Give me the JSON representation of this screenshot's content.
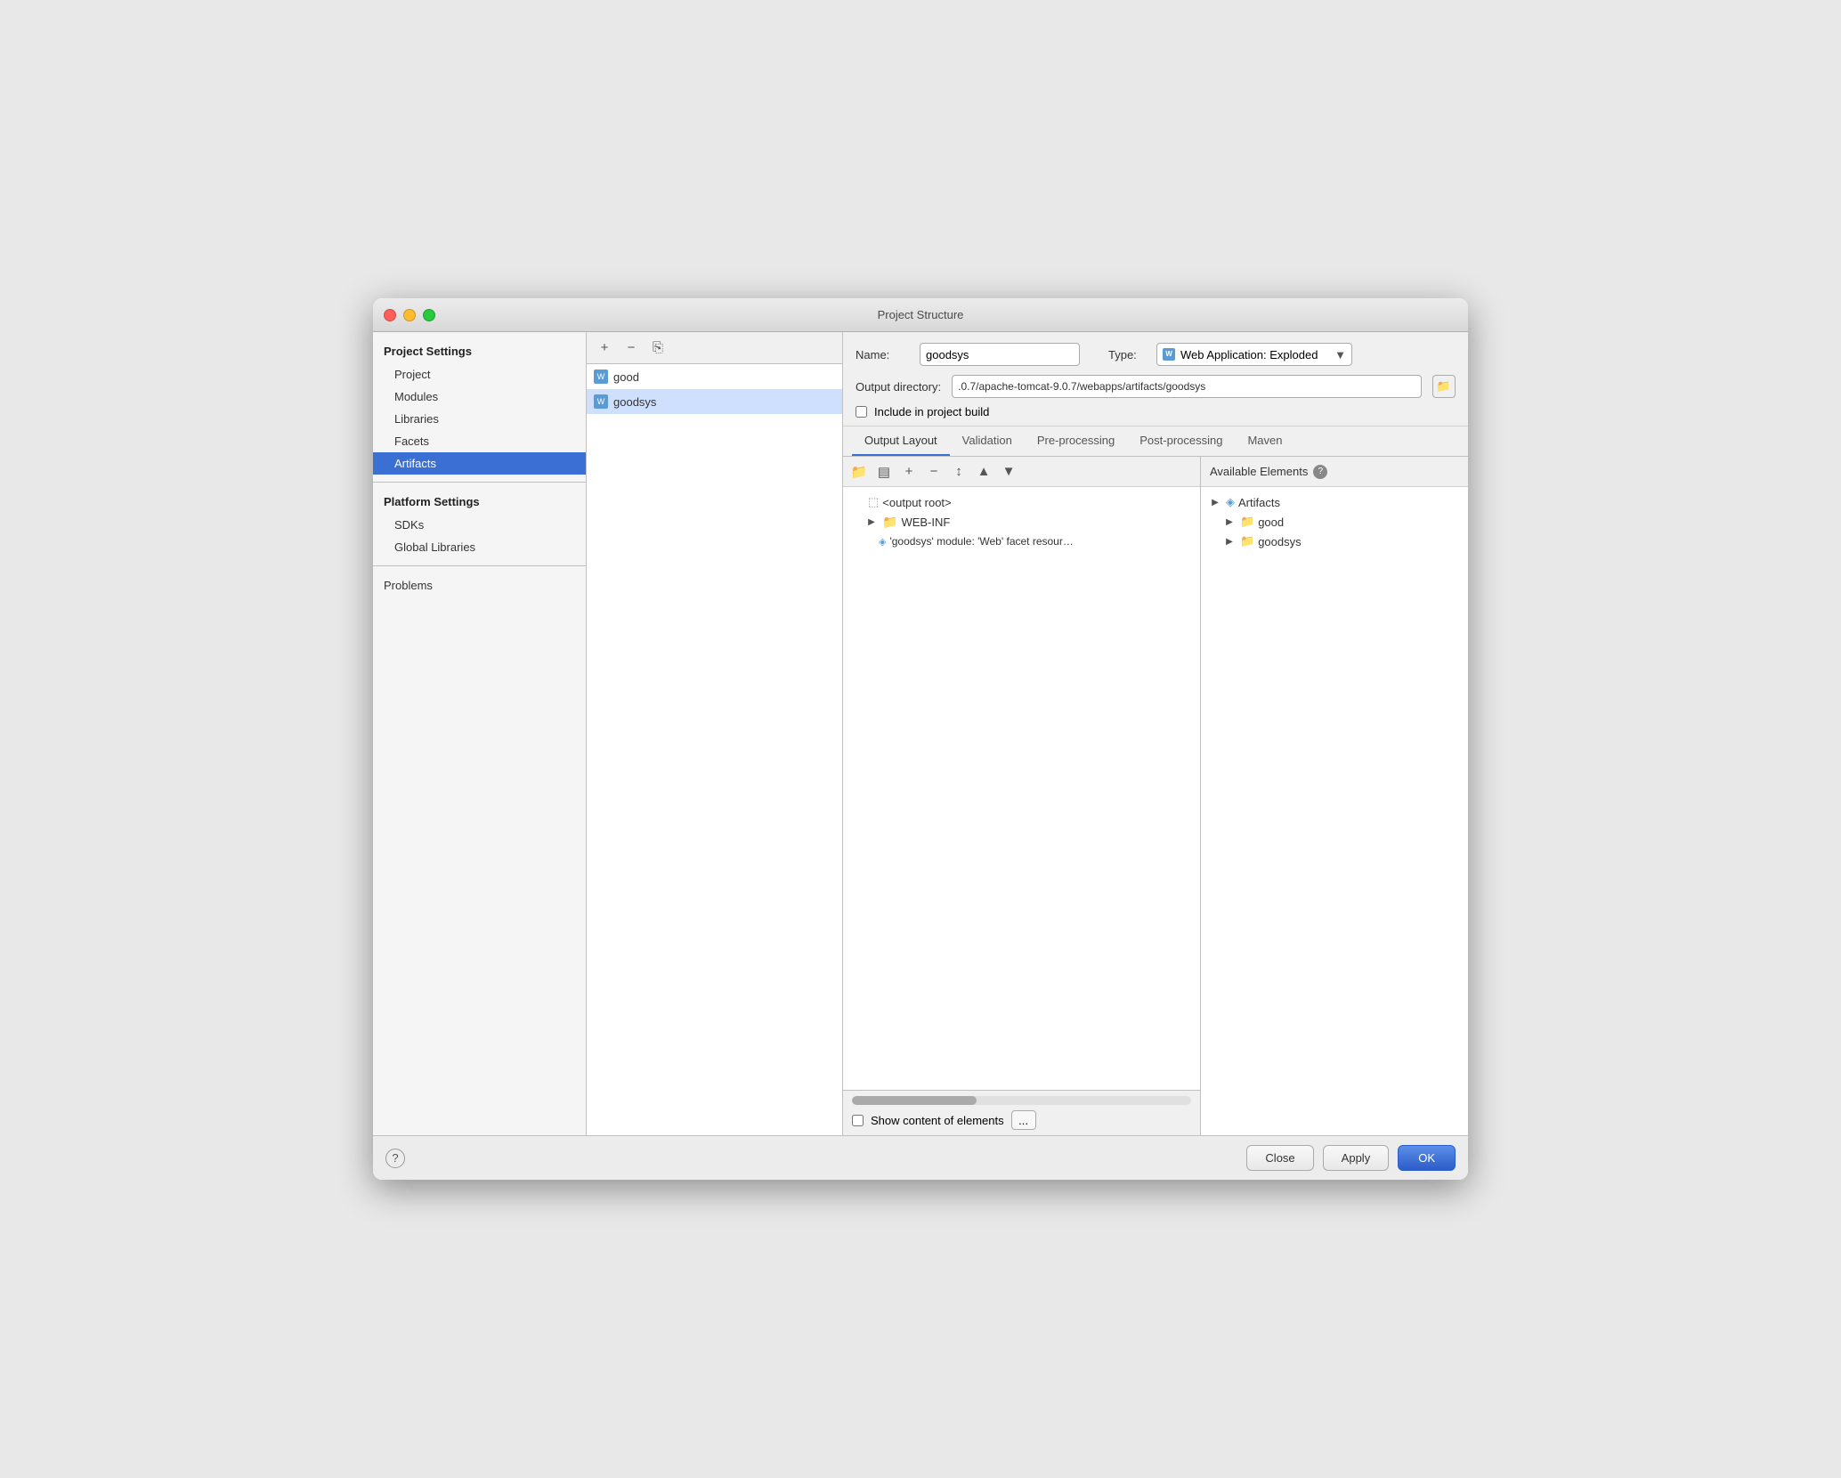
{
  "window": {
    "title": "Project Structure"
  },
  "sidebar": {
    "project_settings_header": "Project Settings",
    "items": [
      {
        "label": "Project",
        "id": "project"
      },
      {
        "label": "Modules",
        "id": "modules"
      },
      {
        "label": "Libraries",
        "id": "libraries"
      },
      {
        "label": "Facets",
        "id": "facets"
      },
      {
        "label": "Artifacts",
        "id": "artifacts",
        "active": true
      }
    ],
    "platform_settings_header": "Platform Settings",
    "platform_items": [
      {
        "label": "SDKs",
        "id": "sdks"
      },
      {
        "label": "Global Libraries",
        "id": "global-libraries"
      }
    ],
    "problems_label": "Problems"
  },
  "artifact_list": {
    "items": [
      {
        "name": "good",
        "id": "good"
      },
      {
        "name": "goodsys",
        "id": "goodsys",
        "selected": true
      }
    ]
  },
  "toolbar": {
    "add": "+",
    "remove": "−",
    "copy": "⎘"
  },
  "detail": {
    "name_label": "Name:",
    "name_value": "goodsys",
    "type_label": "Type:",
    "type_value": "Web Application: Exploded",
    "output_label": "Output directory:",
    "output_value": ".0.7/apache-tomcat-9.0.7/webapps/artifacts/goodsys",
    "include_in_build_label": "Include in project build"
  },
  "tabs": [
    {
      "label": "Output Layout",
      "active": true
    },
    {
      "label": "Validation"
    },
    {
      "label": "Pre-processing"
    },
    {
      "label": "Post-processing"
    },
    {
      "label": "Maven"
    }
  ],
  "tree": {
    "items": [
      {
        "label": "<output root>",
        "indent": 0,
        "type": "root",
        "arrow": false
      },
      {
        "label": "WEB-INF",
        "indent": 1,
        "type": "folder",
        "arrow": true,
        "collapsed": true
      },
      {
        "label": "'goodsys' module: 'Web' facet resour…",
        "indent": 2,
        "type": "module"
      }
    ]
  },
  "available_elements": {
    "header": "Available Elements",
    "items": [
      {
        "label": "Artifacts",
        "indent": 0,
        "type": "artifacts",
        "arrow": true
      },
      {
        "label": "good",
        "indent": 1,
        "type": "folder"
      },
      {
        "label": "goodsys",
        "indent": 1,
        "type": "folder"
      }
    ]
  },
  "bottom": {
    "show_content_label": "Show content of elements",
    "ellipsis": "..."
  },
  "footer": {
    "close_label": "Close",
    "apply_label": "Apply",
    "ok_label": "OK"
  }
}
